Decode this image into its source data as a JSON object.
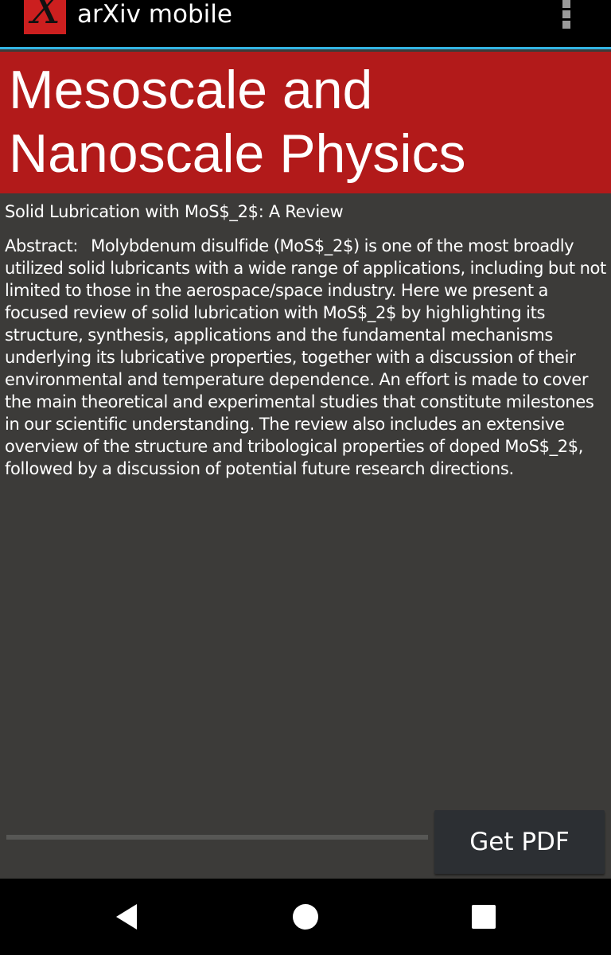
{
  "action_bar": {
    "logo_letter": "X",
    "app_name": "arXiv mobile",
    "menu_icon": "overflow-menu-icon"
  },
  "category": {
    "title": "Mesoscale and Nanoscale Physics"
  },
  "paper": {
    "title": "Solid Lubrication with MoS$_2$: A Review",
    "abstract_label": "Abstract:",
    "abstract_text": "Molybdenum disulfide (MoS$_2$) is one of the most broadly utilized solid lubricants with a wide range of applications, including but not limited to those in the aerospace/space industry. Here we present a focused review of solid lubrication with MoS$_2$ by highlighting its structure, synthesis, applications and the fundamental mechanisms underlying its lubricative properties, together with a discussion of their environmental and temperature dependence. An effort is made to cover the main theoretical and experimental studies that constitute milestones in our scientific understanding. The review also includes an extensive overview of the structure and tribological properties of doped MoS$_2$, followed by a discussion of potential future research directions."
  },
  "download": {
    "progress": 0,
    "button_label": "Get PDF"
  },
  "navigation": {
    "back_icon": "back-triangle-icon",
    "home_icon": "home-circle-icon",
    "recents_icon": "recents-square-icon"
  },
  "colors": {
    "accent": "#33b5e5",
    "header_red": "#b21a1a",
    "background": "#3c3b39"
  }
}
